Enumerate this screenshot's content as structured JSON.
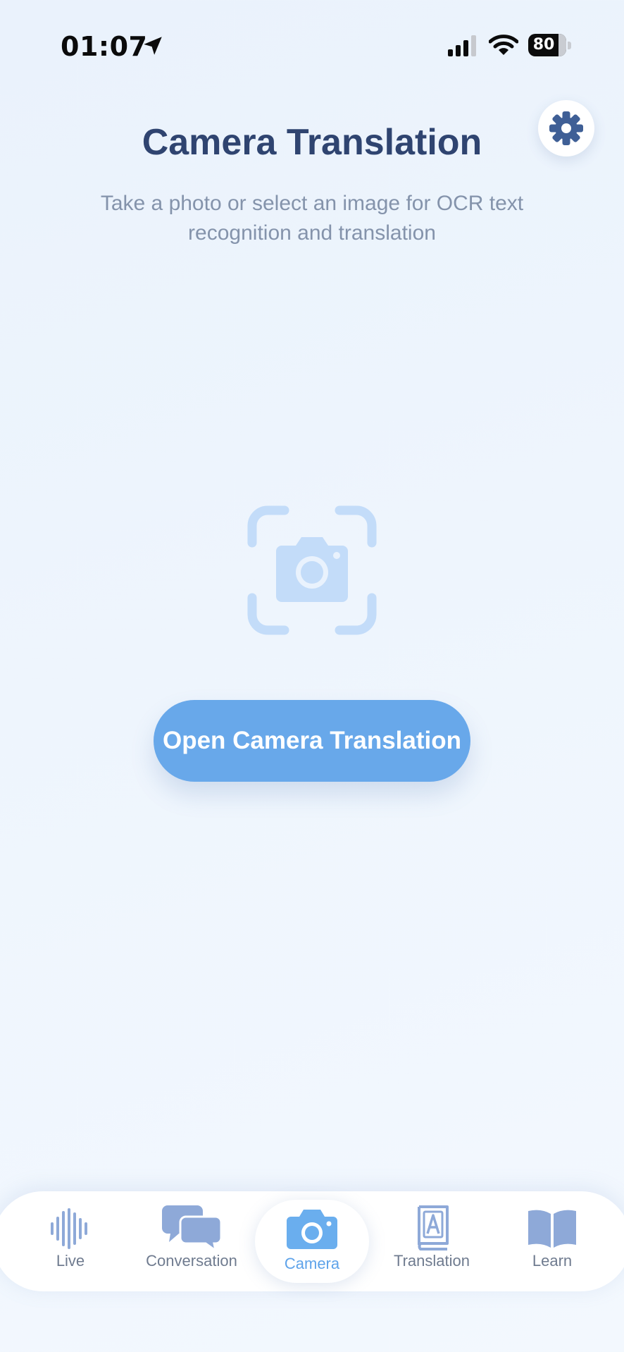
{
  "status_bar": {
    "time": "01:07",
    "battery": "80",
    "battery_level": 0.8
  },
  "header": {
    "title": "Camera Translation",
    "subtitle": "Take a photo or select an image for OCR text recognition and translation"
  },
  "main": {
    "open_camera_label": "Open Camera Translation"
  },
  "tabs": [
    {
      "label": "Live",
      "icon": "waveform-icon"
    },
    {
      "label": "Conversation",
      "icon": "chat-bubbles-icon"
    },
    {
      "label": "Camera",
      "icon": "camera-icon",
      "active": true
    },
    {
      "label": "Translation",
      "icon": "dictionary-book-icon"
    },
    {
      "label": "Learn",
      "icon": "open-book-icon"
    }
  ],
  "colors": {
    "title": "#2f4470",
    "subtitle": "#8493ab",
    "accent": "#68a8ea",
    "active_tab": "#5ea3ea",
    "inactive_tab_icon": "#8ea9d8",
    "illustration": "#c3dcf9",
    "gear": "#3f5f96"
  }
}
